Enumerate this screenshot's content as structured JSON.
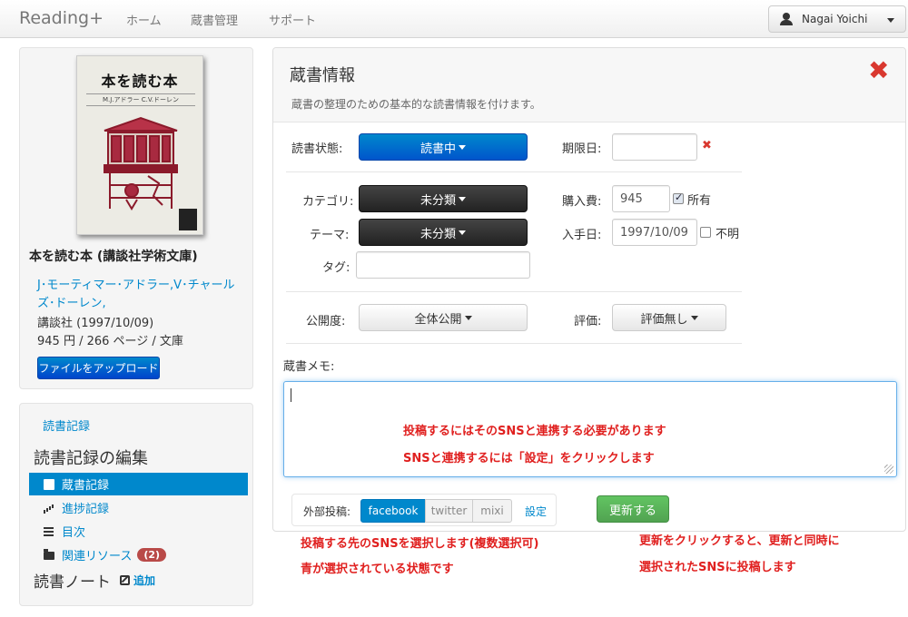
{
  "navbar": {
    "brand": "Reading+",
    "links": [
      "ホーム",
      "蔵書管理",
      "サポート"
    ],
    "user_name": "Nagai Yoichi"
  },
  "book": {
    "cover_title": "本を読む本",
    "cover_subtitle": "M.J.アドラー C.V.ドーレン",
    "title": "本を読む本 (講談社学術文庫)",
    "authors": "J･モーティマー･アドラー,V･チャールズ･ドーレン,",
    "publisher": "講談社 (1997/10/09)",
    "price_pages": "945 円 / 266 ページ / 文庫",
    "upload_label": "ファイルをアップロード"
  },
  "sidebar": {
    "record_link": "読書記録",
    "edit_heading": "読書記録の編集",
    "items": [
      {
        "label": "蔵書記録",
        "active": true,
        "icon": "document-icon"
      },
      {
        "label": "進捗記録",
        "active": false,
        "icon": "bar-chart-icon"
      },
      {
        "label": "目次",
        "active": false,
        "icon": "list-icon"
      },
      {
        "label": "関連リソース",
        "active": false,
        "icon": "folder-icon",
        "badge": "(2)"
      }
    ],
    "note_heading": "読書ノート",
    "add_label": "追加"
  },
  "main": {
    "title": "蔵書情報",
    "description": "蔵書の整理のための基本的な読書情報を付けます。",
    "fields": {
      "status_label": "読書状態:",
      "status_value": "読書中",
      "due_label": "期限日:",
      "due_value": "",
      "category_label": "カテゴリ:",
      "category_value": "未分類",
      "price_label": "購入費:",
      "price_value": "945",
      "owned_label": "所有",
      "owned_checked": true,
      "theme_label": "テーマ:",
      "theme_value": "未分類",
      "acquired_label": "入手日:",
      "acquired_value": "1997/10/09",
      "unknown_label": "不明",
      "unknown_checked": false,
      "tag_label": "タグ:",
      "tag_value": "",
      "visibility_label": "公開度:",
      "visibility_value": "全体公開",
      "rating_label": "評価:",
      "rating_value": "評価無し",
      "memo_label": "蔵書メモ:",
      "memo_value": ""
    },
    "share": {
      "label": "外部投稿:",
      "services": [
        "facebook",
        "twitter",
        "mixi"
      ],
      "selected": "facebook",
      "settings_label": "設定"
    },
    "update_label": "更新する"
  },
  "annotations": {
    "memo_line1": "投稿するにはそのSNSと連携する必要があります",
    "memo_line2": "SNSと連携するには「設定」をクリックします",
    "sns_line1": "投稿する先のSNSを選択します(複数選択可)",
    "sns_line2": "青が選択されている状態です",
    "update_line1": "更新をクリックすると、更新と同時に",
    "update_line2": "選択されたSNSに投稿します"
  },
  "colors": {
    "primary": "#0088cc",
    "dark_button": "#333333",
    "success": "#5bb75b",
    "danger": "#e0201f",
    "badge": "#b94a48"
  }
}
